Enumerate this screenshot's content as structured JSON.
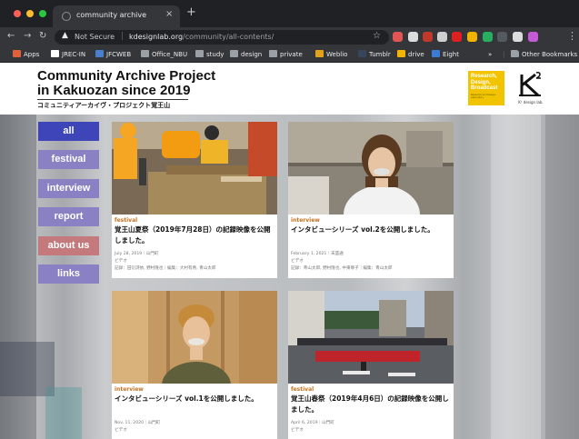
{
  "browser": {
    "tab_title": "community archive",
    "tab_close": "×",
    "new_tab": "+",
    "not_secure_label": "Not Secure",
    "url_host": "kdesignlab.org",
    "url_path": "/community/all-contents/",
    "bookmarks": [
      {
        "label": "Apps",
        "icon": "apps-grid-icon",
        "color": "#e0603a"
      },
      {
        "label": "JREC-IN",
        "icon": "jrec-icon",
        "color": "#ffffff"
      },
      {
        "label": "JFCWEB",
        "icon": "jfcweb-icon",
        "color": "#4a7fd0"
      },
      {
        "label": "Office_NBU",
        "icon": "folder-icon",
        "color": "#9aa0a6"
      },
      {
        "label": "study",
        "icon": "folder-icon",
        "color": "#9aa0a6"
      },
      {
        "label": "design",
        "icon": "folder-icon",
        "color": "#9aa0a6"
      },
      {
        "label": "private",
        "icon": "folder-icon",
        "color": "#9aa0a6"
      },
      {
        "label": "Weblio",
        "icon": "weblio-icon",
        "color": "#e2a31a"
      },
      {
        "label": "Tumblr",
        "icon": "tumblr-icon",
        "color": "#36465d"
      },
      {
        "label": "drive",
        "icon": "drive-icon",
        "color": "#f4b400"
      },
      {
        "label": "Eight",
        "icon": "eight-icon",
        "color": "#3a7bd5"
      }
    ],
    "bookmarks_overflow": "»",
    "other_bookmarks": "Other Bookmarks",
    "extension_colors": [
      "#e25555",
      "#dcdcdc",
      "#c0392b",
      "#cfcfcf",
      "#e02020",
      "#f0b400",
      "#27ae60",
      "#555a60",
      "#dcdcdc",
      "#c45ad6"
    ]
  },
  "site": {
    "title_line1": "Community Archive Project",
    "title_line2": "in Kakuozan since 2019",
    "subtitle": "コミュニティアーカイヴ・プロジェクト覚王山",
    "badge_lines": [
      "Research,",
      "Design,",
      "Broadcast"
    ],
    "badge_small": "Research and Design Laboratory",
    "logo_caption": "K² design lab."
  },
  "nav": [
    {
      "label": "all",
      "style": "all"
    },
    {
      "label": "festival",
      "style": "purple"
    },
    {
      "label": "interview",
      "style": "purple"
    },
    {
      "label": "report",
      "style": "purple"
    },
    {
      "label": "about us",
      "style": "about"
    },
    {
      "label": "links",
      "style": "purple"
    }
  ],
  "cards": [
    {
      "category": "festival",
      "title": "覚王山夏祭（2019年7月28日）の記録映像を公開しました。",
      "date": "July 28, 2019｜山門町",
      "type": "ビデオ",
      "credits": "記録：田衍詩依, 野村隆也｜編集：大村有希, 青山太郎",
      "image": "festival-volunteers-photo"
    },
    {
      "category": "interview",
      "title": "インタビューシリーズ vol.2を公開しました。",
      "date": "February 1, 2021｜末盛通",
      "type": "ビデオ",
      "credits": "記録：青山太郎, 野村隆也, 中東尊子｜編集：青山太郎",
      "image": "interview-woman-photo"
    },
    {
      "category": "interview",
      "title": "インタビューシリーズ vol.1を公開しました。",
      "date": "Nov. 11, 2020｜山門町",
      "type": "ビデオ",
      "credits": "",
      "image": "interview-man-photo"
    },
    {
      "category": "festival",
      "title": "覚王山春祭（2019年4月6日）の記録映像を公開しました。",
      "date": "April 6, 2019｜山門町",
      "type": "ビデオ",
      "credits": "",
      "image": "spring-festival-street-photo"
    }
  ]
}
